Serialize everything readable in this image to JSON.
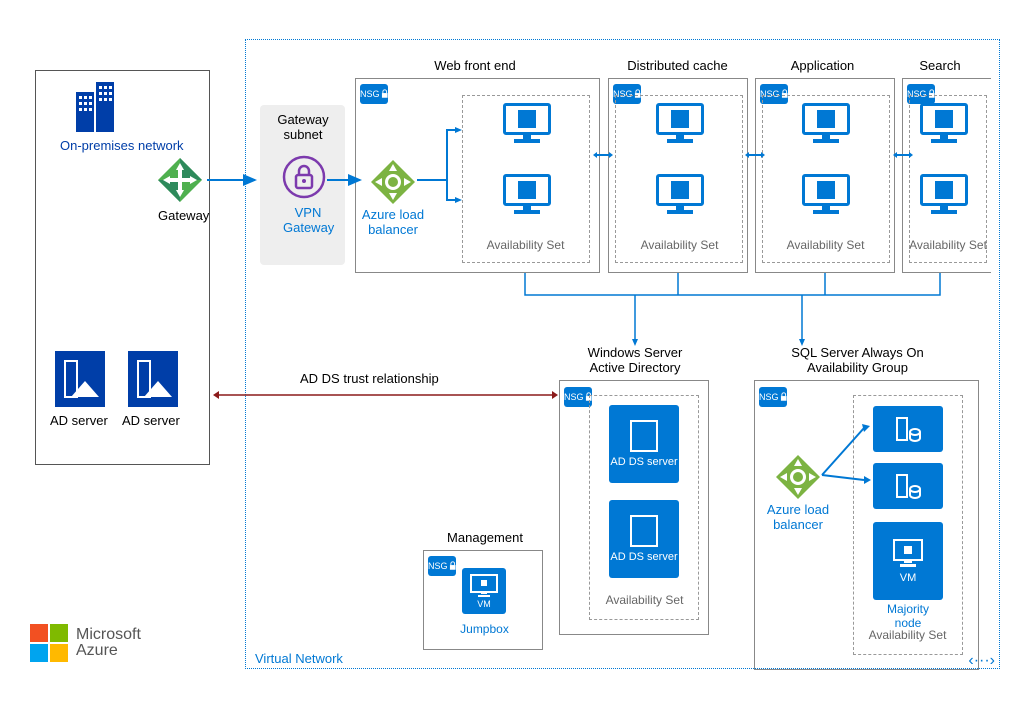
{
  "onprem": {
    "title": "On-premises\nnetwork",
    "gateway": "Gateway",
    "ad_server": "AD server"
  },
  "vnet": {
    "label": "Virtual Network"
  },
  "gateway_subnet": {
    "title": "Gateway subnet",
    "vpn": "VPN Gateway"
  },
  "nsg": "NSG",
  "tiers": {
    "web": "Web front end",
    "dist": "Distributed cache",
    "app": "Application",
    "search": "Search",
    "ad": "Windows Server Active Directory",
    "sql": "SQL Server Always On Availability Group",
    "mgmt": "Management"
  },
  "lb": "Azure load balancer",
  "avail": "Availability Set",
  "adds": "AD DS server",
  "majority": "Majority node",
  "vm": "VM",
  "jumpbox": "Jumpbox",
  "trust": "AD DS trust relationship",
  "logo": {
    "ms": "Microsoft",
    "az": "Azure"
  }
}
